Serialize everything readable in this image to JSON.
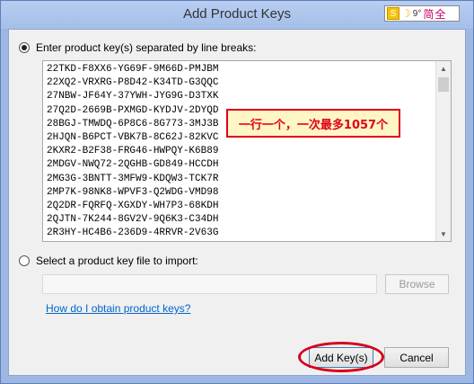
{
  "window": {
    "title": "Add Product Keys"
  },
  "ime_bar": {
    "text": "简全"
  },
  "options": {
    "enter_keys_label": "Enter product key(s) separated by line breaks:",
    "import_file_label": "Select a product key file to import:"
  },
  "keys": [
    "22TKD-F8XX6-YG69F-9M66D-PMJBM",
    "22XQ2-VRXRG-P8D42-K34TD-G3QQC",
    "27NBW-JF64Y-37YWH-JYG9G-D3TXK",
    "27Q2D-2669B-PXMGD-KYDJV-2DYQD",
    "28BGJ-TMWDQ-6P8C6-8G773-3MJ3B",
    "2HJQN-B6PCT-VBK7B-8C62J-82KVC",
    "2KXR2-B2F38-FRG46-HWPQY-K6B89",
    "2MDGV-NWQ72-2QGHB-GD849-HCCDH",
    "2MG3G-3BNTT-3MFW9-KDQW3-TCK7R",
    "2MP7K-98NK8-WPVF3-Q2WDG-VMD98",
    "2Q2DR-FQRFQ-XGXDY-WH7P3-68KDH",
    "2QJTN-7K244-8GV2V-9Q6K3-C34DH",
    "2R3HY-HC4B6-236D9-4RRVR-2V63G"
  ],
  "annotation": {
    "text": "一行一个，一次最多1057个"
  },
  "file_import": {
    "value": "",
    "browse_label": "Browse"
  },
  "help_link": "How do I obtain product keys?",
  "buttons": {
    "add_label": "Add Key(s)",
    "cancel_label": "Cancel"
  },
  "colors": {
    "annotation": "#e0001b",
    "link": "#0066cc",
    "titlebar": "#a5bfea"
  }
}
